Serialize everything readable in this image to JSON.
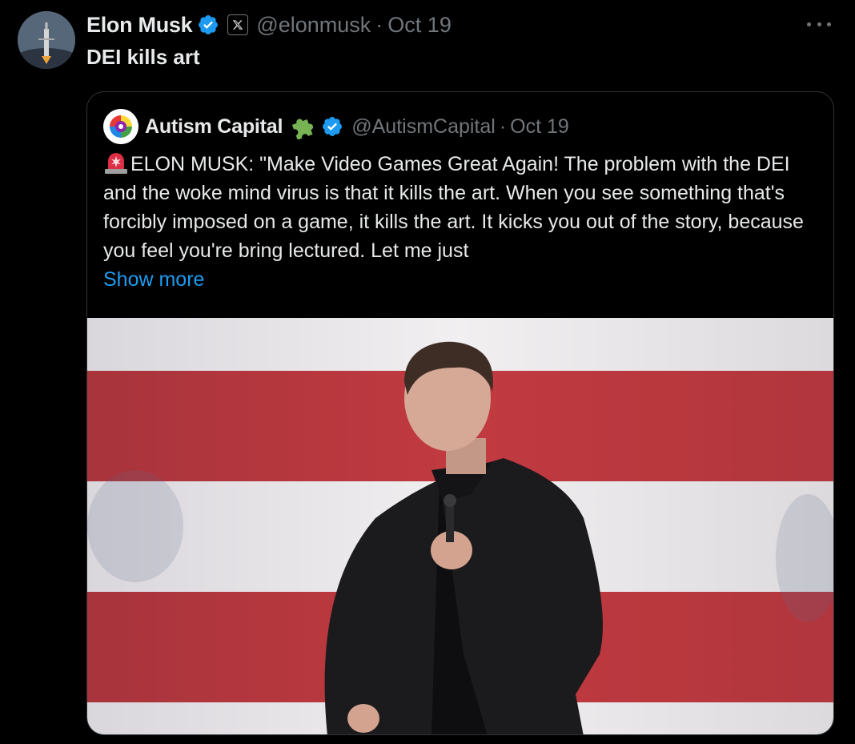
{
  "tweet": {
    "author_name": "Elon Musk",
    "handle": "@elonmusk",
    "separator": "·",
    "date": "Oct 19",
    "text": "DEI kills art"
  },
  "quote": {
    "author_name": "Autism Capital",
    "handle": "@AutismCapital",
    "separator": "·",
    "date": "Oct 19",
    "body": "ELON MUSK: \"Make Video Games Great Again! The problem with the DEI and the woke mind virus is that it kills the art. When you see something that's forcibly imposed on a game, it kills the art. It kicks you out of the story, because you feel you're bring lectured. Let me just",
    "show_more": "Show more"
  },
  "colors": {
    "background": "#000000",
    "text_primary": "#e7e9ea",
    "text_secondary": "#71767b",
    "link": "#1d9bf0",
    "verified": "#1d9bf0",
    "flag_red": "#b8323a",
    "flag_white": "#e6e4e6"
  },
  "icons": {
    "verified": "verified-badge-icon",
    "x_logo": "x-logo-icon",
    "more": "more-options-icon",
    "puzzle": "puzzle-piece-icon",
    "siren": "rotating-light-icon"
  }
}
